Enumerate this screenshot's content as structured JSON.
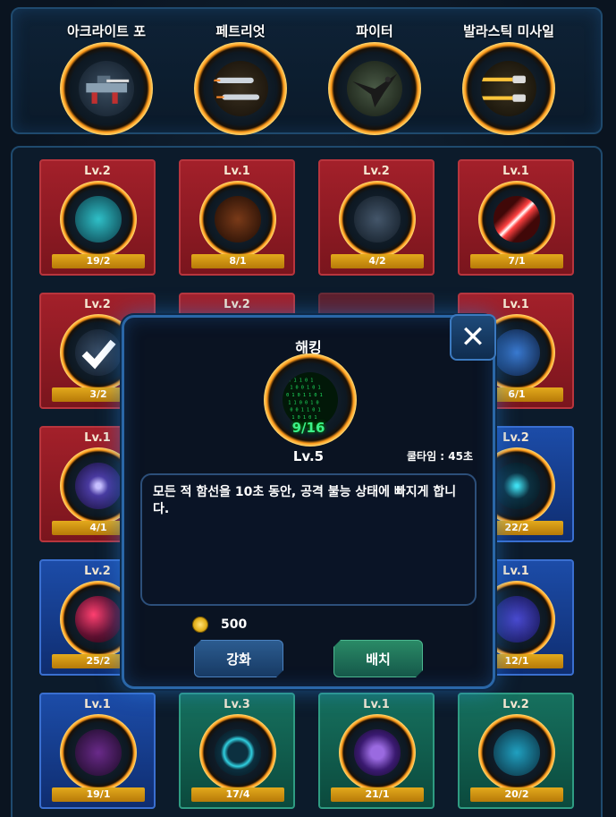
{
  "equipped": [
    {
      "label": "아크라이트 포",
      "icon": "battleship-icon"
    },
    {
      "label": "페트리엇",
      "icon": "missile-icon"
    },
    {
      "label": "파이터",
      "icon": "eagle-icon"
    },
    {
      "label": "발라스틱 미사일",
      "icon": "ballistic-missile-icon"
    }
  ],
  "cards": [
    {
      "lv": "Lv.2",
      "count": "19/2",
      "color": "red",
      "icon": "light-beam-icon"
    },
    {
      "lv": "Lv.1",
      "count": "8/1",
      "color": "red",
      "icon": "shield-ring-icon"
    },
    {
      "lv": "Lv.2",
      "count": "4/2",
      "color": "red",
      "icon": "battleship-icon"
    },
    {
      "lv": "Lv.1",
      "count": "7/1",
      "color": "red",
      "icon": "laser-slash-icon"
    },
    {
      "lv": "Lv.2",
      "count": "3/2",
      "color": "red",
      "icon": "checkmark-icon"
    },
    {
      "lv": "Lv.2",
      "count": "",
      "color": "red",
      "icon": ""
    },
    {
      "lv": "",
      "count": "",
      "color": "red",
      "icon": ""
    },
    {
      "lv": "Lv.1",
      "count": "6/1",
      "color": "red",
      "icon": "eye-scan-icon"
    },
    {
      "lv": "Lv.1",
      "count": "4/1",
      "color": "red",
      "icon": "orb-icon"
    },
    {
      "lv": "",
      "count": "",
      "color": "blue",
      "icon": ""
    },
    {
      "lv": "",
      "count": "",
      "color": "blue",
      "icon": ""
    },
    {
      "lv": "Lv.2",
      "count": "22/2",
      "color": "blue",
      "icon": "cross-beam-icon"
    },
    {
      "lv": "Lv.2",
      "count": "25/2",
      "color": "blue",
      "icon": "hex-sphere-icon"
    },
    {
      "lv": "",
      "count": "",
      "color": "blue",
      "icon": ""
    },
    {
      "lv": "",
      "count": "",
      "color": "blue",
      "icon": ""
    },
    {
      "lv": "Lv.1",
      "count": "12/1",
      "color": "blue",
      "icon": "crystal-icon"
    },
    {
      "lv": "Lv.1",
      "count": "19/1",
      "color": "blue",
      "icon": "hex-grid-icon"
    },
    {
      "lv": "Lv.3",
      "count": "17/4",
      "color": "green",
      "icon": "portal-icon"
    },
    {
      "lv": "Lv.1",
      "count": "21/1",
      "color": "green",
      "icon": "chip-icon"
    },
    {
      "lv": "Lv.2",
      "count": "20/2",
      "color": "green",
      "icon": "chevron-icon"
    }
  ],
  "popup": {
    "title": "해킹",
    "progress": "9/16",
    "level": "Lv.5",
    "cooldown": "쿨타임 : 45초",
    "description": "모든 적 함선을 10초 동안, 공격 불능 상태에 빠지게 합니다.",
    "cost": "500",
    "upgrade_label": "강화",
    "deploy_label": "배치",
    "close_symbol": "✕"
  },
  "colors": {
    "red": "#a3202a",
    "blue": "#1c4ca8",
    "green": "#16705e",
    "gold": "#e2a91c"
  }
}
